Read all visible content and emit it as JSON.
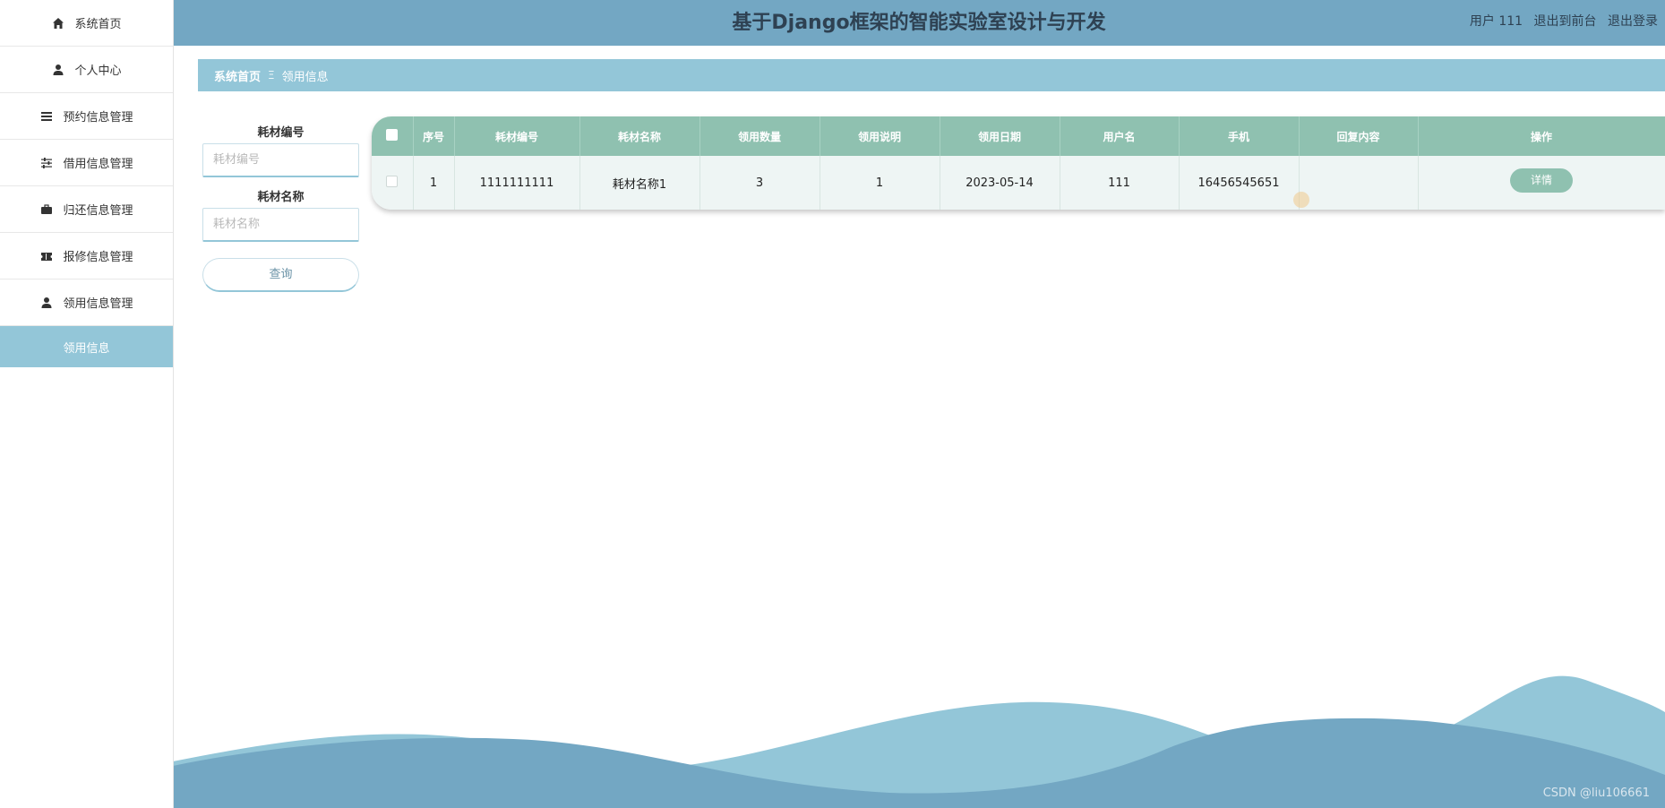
{
  "header": {
    "title": "基于Django框架的智能实验室设计与开发",
    "user_label": "用户 111",
    "back_front": "退出到前台",
    "logout": "退出登录"
  },
  "sidebar": {
    "items": [
      {
        "label": "系统首页",
        "icon": "home-icon"
      },
      {
        "label": "个人中心",
        "icon": "person-icon"
      },
      {
        "label": "预约信息管理",
        "icon": "list-icon"
      },
      {
        "label": "借用信息管理",
        "icon": "sliders-icon"
      },
      {
        "label": "归还信息管理",
        "icon": "briefcase-icon"
      },
      {
        "label": "报修信息管理",
        "icon": "ticket-icon"
      },
      {
        "label": "领用信息管理",
        "icon": "user-icon"
      }
    ],
    "active_sub": "领用信息"
  },
  "breadcrumb": {
    "home": "系统首页",
    "separator": "Ξ",
    "current": "领用信息"
  },
  "search": {
    "field1_label": "耗材编号",
    "field1_placeholder": "耗材编号",
    "field1_value": "",
    "field2_label": "耗材名称",
    "field2_placeholder": "耗材名称",
    "field2_value": "",
    "query_button": "查询"
  },
  "table": {
    "columns": [
      "序号",
      "耗材编号",
      "耗材名称",
      "领用数量",
      "领用说明",
      "领用日期",
      "用户名",
      "手机",
      "回复内容",
      "操作"
    ],
    "rows": [
      {
        "index": "1",
        "code": "1111111111",
        "name": "耗材名称1",
        "quantity": "3",
        "note": "1",
        "date": "2023-05-14",
        "username": "111",
        "phone": "16456545651",
        "reply": "",
        "action": "详情"
      }
    ]
  },
  "colors": {
    "header_bg": "#73a7c3",
    "breadcrumb_bg": "#93c6d8",
    "table_header_bg": "#8fc1b0",
    "wave_light": "#93c6d8",
    "wave_dark": "#73a7c3"
  },
  "watermark": "CSDN @liu106661"
}
